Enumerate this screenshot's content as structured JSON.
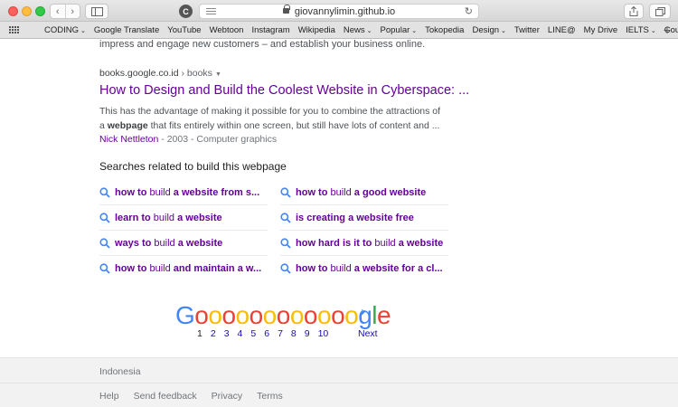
{
  "browser": {
    "url": "giovannylimin.github.io",
    "bookmarks": [
      {
        "label": "CODING",
        "dropdown": true
      },
      {
        "label": "Google Translate",
        "dropdown": false
      },
      {
        "label": "YouTube",
        "dropdown": false
      },
      {
        "label": "Webtoon",
        "dropdown": false
      },
      {
        "label": "Instagram",
        "dropdown": false
      },
      {
        "label": "Wikipedia",
        "dropdown": false
      },
      {
        "label": "News",
        "dropdown": true
      },
      {
        "label": "Popular",
        "dropdown": true
      },
      {
        "label": "Tokopedia",
        "dropdown": false
      },
      {
        "label": "Design",
        "dropdown": true
      },
      {
        "label": "Twitter",
        "dropdown": false
      },
      {
        "label": "LINE@",
        "dropdown": false
      },
      {
        "label": "My Drive",
        "dropdown": false
      },
      {
        "label": "IELTS",
        "dropdown": true
      },
      {
        "label": "Coursera",
        "dropdown": false
      }
    ]
  },
  "previous_snippet": "impress and engage new customers – and establish your business online.",
  "result": {
    "cite_domain": "books.google.co.id",
    "cite_path": " › books",
    "title": "How to Design and Build the Coolest Website in Cyberspace: ...",
    "desc_before": "This has the advantage of making it possible for you to combine the attractions of a ",
    "desc_bold": "webpage",
    "desc_after": " that fits entirely within one screen, but still have lots of content and ...",
    "author": "Nick Nettleton",
    "meta": " - 2003 - Computer graphics"
  },
  "related": {
    "heading": "Searches related to build this webpage",
    "items": [
      {
        "bold1": "how to",
        "plain": " build ",
        "bold2": "a website from s..."
      },
      {
        "bold1": "how to",
        "plain": " build ",
        "bold2": "a good website"
      },
      {
        "bold1": "learn to",
        "plain": " build ",
        "bold2": "a website"
      },
      {
        "bold1": "is creating a website free",
        "plain": "",
        "bold2": ""
      },
      {
        "bold1": "ways to",
        "plain": " build ",
        "bold2": "a website"
      },
      {
        "bold1": "how hard is it to",
        "plain": " build ",
        "bold2": "a website"
      },
      {
        "bold1": "how to",
        "plain": " build ",
        "bold2": "and maintain a w..."
      },
      {
        "bold1": "how to",
        "plain": " build ",
        "bold2": "a website for a cl..."
      }
    ]
  },
  "pagination": {
    "logo": {
      "g": "G",
      "o": "oooooooooooo",
      "gle_g": "g",
      "gle_l": "l",
      "gle_e": "e"
    },
    "pages": [
      "1",
      "2",
      "3",
      "4",
      "5",
      "6",
      "7",
      "8",
      "9",
      "10"
    ],
    "current": "1",
    "next_label": "Next",
    "next_arrow": "›"
  },
  "footer": {
    "country": "Indonesia",
    "links": [
      "Help",
      "Send feedback",
      "Privacy",
      "Terms"
    ]
  }
}
